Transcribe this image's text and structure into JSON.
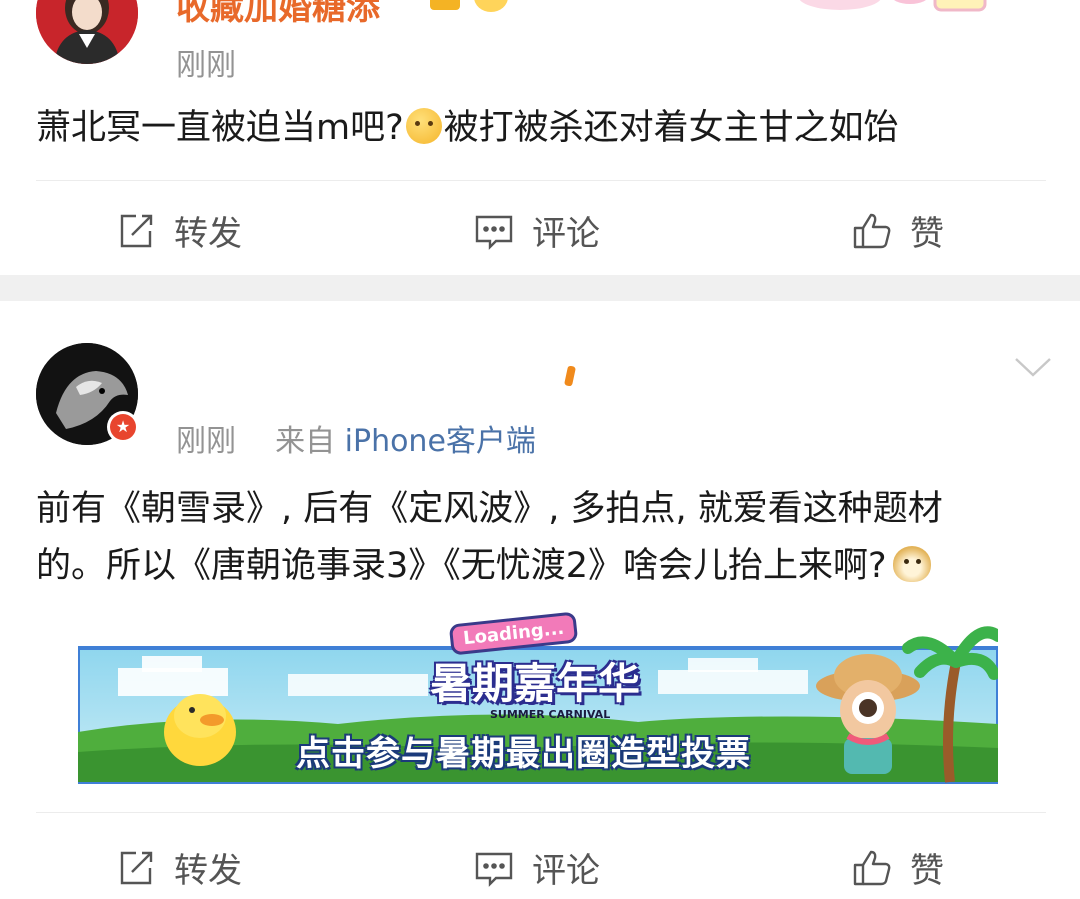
{
  "post1": {
    "username": "收藏加婚糖添",
    "time": "刚刚",
    "content_before_emoji": "萧北冥一直被迫当m吧?",
    "content_after_emoji": "被打被杀还对着女主甘之如饴",
    "actions": {
      "repost": "转发",
      "comment": "评论",
      "like": "赞"
    }
  },
  "post2": {
    "time": "刚刚",
    "source_prefix": "来自",
    "source": "iPhone客户端",
    "content_line1": "前有《朝雪录》, 后有《定风波》, 多拍点, 就爱看这种题材",
    "content_line2": "的。所以《唐朝诡事录3》《无忧渡2》啥会儿抬上来啊?",
    "banner": {
      "badge": "Loading...",
      "title": "暑期嘉年华",
      "subtitle_en": "SUMMER CARNIVAL",
      "caption": "点击参与暑期最出圈造型投票"
    },
    "actions": {
      "repost": "转发",
      "comment": "评论",
      "like": "赞"
    }
  },
  "icons": {
    "repost": "share-icon",
    "comment": "comment-icon",
    "like": "thumbs-up-icon",
    "expand": "chevron-down-icon"
  },
  "colors": {
    "username": "#e8692a",
    "meta": "#939393",
    "source_link": "#4a72a8",
    "separator": "#f0f0f0"
  }
}
